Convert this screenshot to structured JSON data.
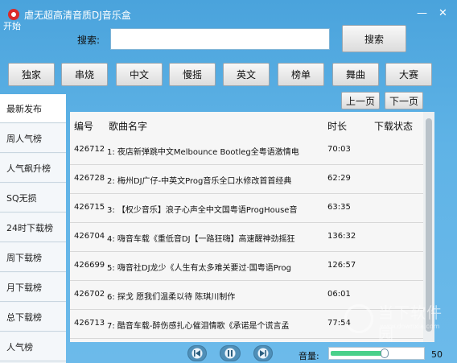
{
  "window": {
    "title": "虐无超高清音质DJ音乐盒",
    "start_label": "开始",
    "minimize": "—",
    "close": "✕"
  },
  "search": {
    "label": "搜索:",
    "value": "",
    "button": "搜索"
  },
  "categories": [
    "独家",
    "串烧",
    "中文",
    "慢摇",
    "英文",
    "榜单",
    "舞曲",
    "大赛"
  ],
  "pagination": {
    "prev": "上一页",
    "next": "下一页"
  },
  "sidebar": {
    "items": [
      "最新发布",
      "周人气榜",
      "人气飙升榜",
      "SQ无损",
      "24时下载榜",
      "周下载榜",
      "月下载榜",
      "总下载榜",
      "人气榜"
    ],
    "active_index": 0
  },
  "table": {
    "headers": {
      "id": "编号",
      "name": "歌曲名字",
      "duration": "时长",
      "status": "下载状态"
    },
    "rows": [
      {
        "id": "426712",
        "name": "1: 夜店新弹跳中文Melbounce Bootleg全粤语激情电",
        "duration": "70:03"
      },
      {
        "id": "426728",
        "name": "2: 梅州DJ广仔-中英文Prog音乐全口水修改首首经典",
        "duration": "62:29"
      },
      {
        "id": "426715",
        "name": "3: 【权少音乐】浪子心声全中文国粤语ProgHouse音",
        "duration": "63:35"
      },
      {
        "id": "426704",
        "name": "4: 嗨音车载《重低音DJ【一路狂嗨】高速醒神劲摇狂",
        "duration": "136:32"
      },
      {
        "id": "426699",
        "name": "5: 嗨音社DJ龙少《人生有太多难关要过·国粤语Prog",
        "duration": "126:57"
      },
      {
        "id": "426702",
        "name": "6: 探戈     愿我们温柔以待   陈琪川制作",
        "duration": "06:01"
      },
      {
        "id": "426713",
        "name": "7: 酷音车载-醉伤感扎心催泪情歌《承诺是个谎言孟",
        "duration": "77:54"
      }
    ]
  },
  "player": {
    "prev_icon": "prev-icon",
    "pause_icon": "pause-icon",
    "next_icon": "next-icon",
    "volume_label": "音量:",
    "volume": 50,
    "volume_max": 100
  },
  "watermark": {
    "text": "当下软件园",
    "sub": "www.downxia.com"
  },
  "colors": {
    "background": "#5fb3e6",
    "volume_fill": "#49d08a",
    "app_icon": "#d92a2a"
  }
}
